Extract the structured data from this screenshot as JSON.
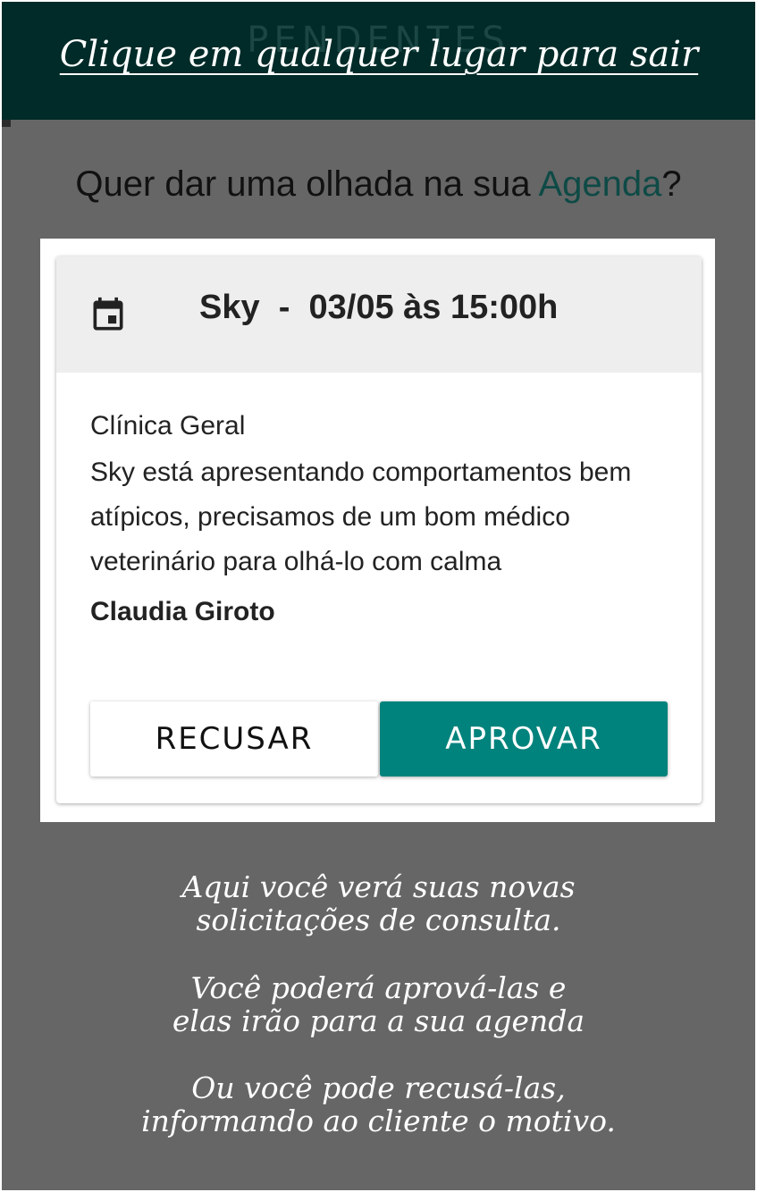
{
  "overlay": {
    "background_title": "PENDENTES",
    "exit_hint": "Clique em qualquer lugar para sair",
    "colors": {
      "topbar": "#002b28",
      "overlay": "#666666",
      "accent": "#00837c"
    }
  },
  "agenda_prompt": {
    "before": "Quer dar uma olhada na sua ",
    "link": "Agenda",
    "after": "?"
  },
  "request_card": {
    "icon": "calendar-icon",
    "title": "Sky  -  03/05 às 15:00h",
    "specialty": "Clínica Geral",
    "description": "Sky está apresentando comportamentos bem atípicos, precisamos de um bom médico veterinário para olhá-lo com calma",
    "client": "Claudia Giroto",
    "reject_label": "RECUSAR",
    "approve_label": "APROVAR"
  },
  "hints": {
    "new_requests": [
      "Aqui você verá suas novas",
      "solicitações de consulta."
    ],
    "approve": [
      "Você poderá aprová-las e",
      "elas irão para a sua agenda"
    ],
    "reject": [
      "Ou você pode recusá-las,",
      "informando ao cliente o motivo."
    ]
  }
}
